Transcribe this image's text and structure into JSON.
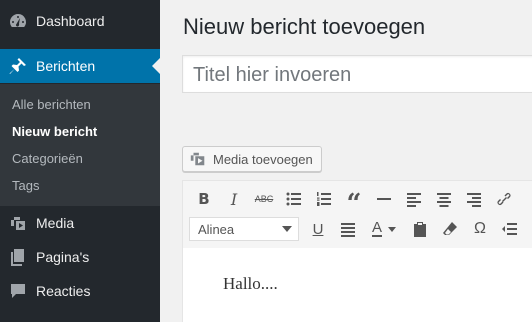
{
  "sidebar": {
    "dashboard": "Dashboard",
    "posts": "Berichten",
    "submenu": [
      "Alle berichten",
      "Nieuw bericht",
      "Categorieën",
      "Tags"
    ],
    "media": "Media",
    "pages": "Pagina's",
    "comments": "Reacties"
  },
  "main": {
    "title": "Nieuw bericht toevoegen",
    "title_placeholder": "Titel hier invoeren",
    "add_media": "Media toevoegen",
    "format_select": "Alinea",
    "content": "Hallo...."
  },
  "colors": {
    "sidebar_bg": "#23282d",
    "accent": "#0073aa",
    "submenu_bg": "#32373c"
  }
}
